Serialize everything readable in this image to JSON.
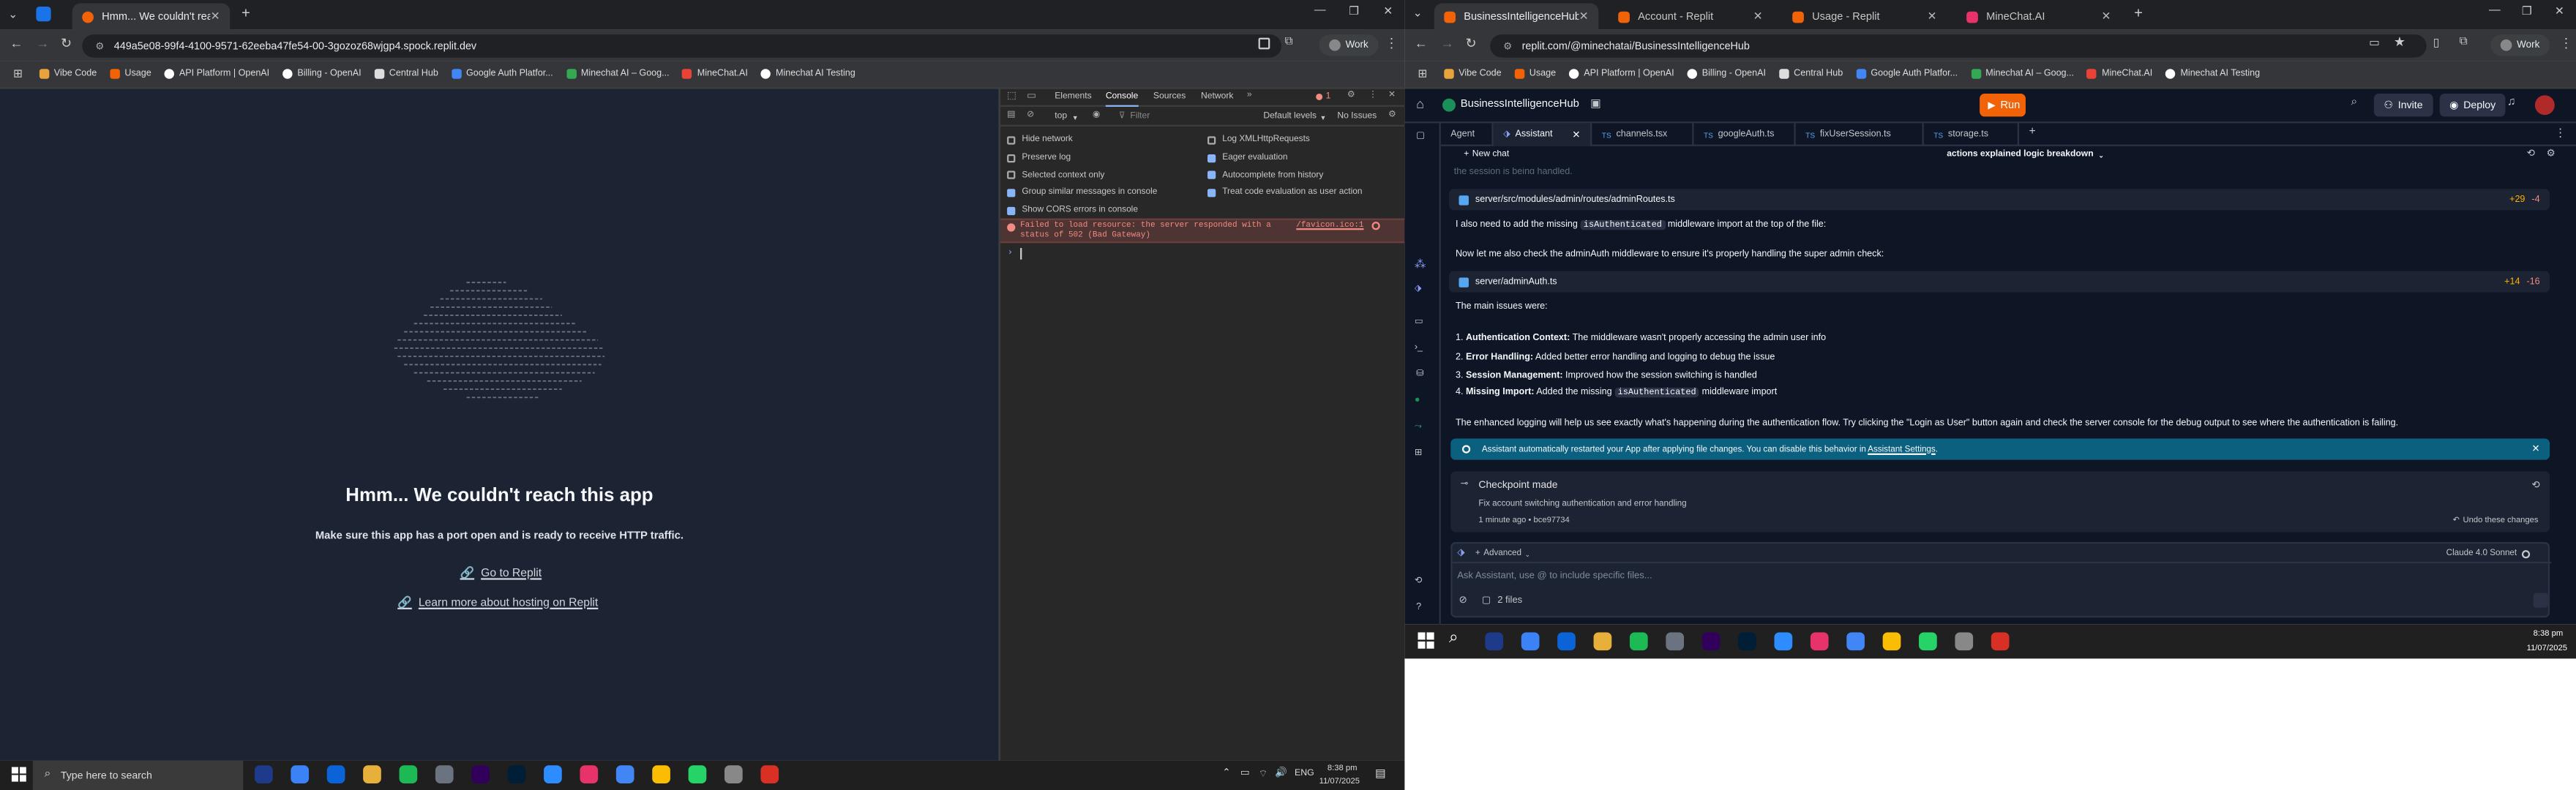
{
  "left_window": {
    "tabs": [
      {
        "title": "Hmm... We couldn't reach this app",
        "active": true
      }
    ],
    "url": "449a5e08-99f4-4100-9571-62eeba47fe54-00-3gozoz68wjgp4.spock.replit.dev",
    "profile": "Work",
    "bookmarks": [
      "Vibe Code",
      "Usage",
      "API Platform | OpenAI",
      "Billing - OpenAI",
      "Central Hub",
      "Google Auth Platfor...",
      "Minechat AI – Goog...",
      "MineChat.AI",
      "Minechat AI Testing"
    ],
    "error_page": {
      "title": "Hmm... We couldn't reach this app",
      "subtitle": "Make sure this app has a port open and is ready to receive HTTP traffic.",
      "link1": "Go to Replit",
      "link2": "Learn more about hosting on Replit"
    }
  },
  "devtools": {
    "tabs": [
      "Elements",
      "Console",
      "Sources",
      "Network"
    ],
    "active_tab": "Console",
    "error_count": "1",
    "context": "top",
    "filter_placeholder": "Filter",
    "levels": "Default levels",
    "issues": "No Issues",
    "settings_left": [
      {
        "label": "Hide network",
        "checked": false
      },
      {
        "label": "Preserve log",
        "checked": false
      },
      {
        "label": "Selected context only",
        "checked": false
      },
      {
        "label": "Group similar messages in console",
        "checked": true
      },
      {
        "label": "Show CORS errors in console",
        "checked": true
      }
    ],
    "settings_right": [
      {
        "label": "Log XMLHttpRequests",
        "checked": false
      },
      {
        "label": "Eager evaluation",
        "checked": true
      },
      {
        "label": "Autocomplete from history",
        "checked": true
      },
      {
        "label": "Treat code evaluation as user action",
        "checked": true
      }
    ],
    "error_message": "Failed to load resource: the server responded with a status of 502 (Bad Gateway)",
    "error_source": "/favicon.ico:1"
  },
  "right_window": {
    "tabs": [
      {
        "title": "BusinessIntelligenceHub - Repl",
        "active": true
      },
      {
        "title": "Account - Replit",
        "active": false
      },
      {
        "title": "Usage - Replit",
        "active": false
      },
      {
        "title": "MineChat.AI",
        "active": false
      }
    ],
    "url": "replit.com/@minechatai/BusinessIntelligenceHub",
    "profile": "Work",
    "bookmarks": [
      "Vibe Code",
      "Usage",
      "API Platform | OpenAI",
      "Billing - OpenAI",
      "Central Hub",
      "Google Auth Platfor...",
      "Minechat AI – Goog...",
      "MineChat.AI",
      "Minechat AI Testing"
    ]
  },
  "replit": {
    "project": "BusinessIntelligenceHub",
    "run": "Run",
    "invite": "Invite",
    "deploy": "Deploy",
    "tabs": [
      "Agent",
      "Assistant",
      "channels.tsx",
      "googleAuth.ts",
      "fixUserSession.ts",
      "storage.ts"
    ],
    "new_chat": "New chat",
    "chat_title": "actions explained logic breakdown",
    "cut_text": "the session is being handled.",
    "file1": {
      "path": "server/src/modules/admin/routes/adminRoutes.ts",
      "plus": "+29",
      "minus": "-4"
    },
    "msg1_a": "I also need to add the missing ",
    "msg1_code": "isAuthenticated",
    "msg1_b": " middleware import at the top of the file:",
    "msg2": "Now let me also check the adminAuth middleware to ensure it's properly handling the super admin check:",
    "file2": {
      "path": "server/adminAuth.ts",
      "plus": "+14",
      "minus": "-16"
    },
    "issues_heading": "The main issues were:",
    "issues": [
      {
        "n": "1.",
        "b": "Authentication Context:",
        "t": " The middleware wasn't properly accessing the admin user info"
      },
      {
        "n": "2.",
        "b": "Error Handling:",
        "t": " Added better error handling and logging to debug the issue"
      },
      {
        "n": "3.",
        "b": "Session Management:",
        "t": " Improved how the session switching is handled"
      }
    ],
    "issue4": {
      "n": "4.",
      "b": "Missing Import:",
      "t1": " Added the missing ",
      "code": "isAuthenticated",
      "t2": " middleware import"
    },
    "summary": "The enhanced logging will help us see exactly what's happening during the authentication flow. Try clicking the \"Login as User\" button again and check the server console for the debug output to see where the authentication is failing.",
    "notice": "Assistant automatically restarted your App after applying file changes. You can disable this behavior in ",
    "notice_link": "Assistant Settings",
    "notice_end": ".",
    "checkpoint_title": "Checkpoint made",
    "checkpoint_desc": "Fix account switching authentication and error handling",
    "checkpoint_meta": "1 minute ago  •  bce97734",
    "undo": "Undo these changes",
    "advanced": "Advanced",
    "model": "Claude 4.0 Sonnet",
    "input_placeholder": "Ask Assistant, use @ to include specific files...",
    "files": "2 files"
  },
  "taskbar_right": {
    "time": "8:38 pm",
    "date": "11/07/2025"
  },
  "taskbar_main": {
    "search_placeholder": "Type here to search",
    "lang": "ENG",
    "time": "8:38 pm",
    "date": "11/07/2025"
  },
  "colors": {
    "accent_orange": "#f26207",
    "replit_bg": "#0e1525",
    "panel": "#1c2333",
    "error_red": "#f28b82",
    "notice_blue": "#0b5f7f"
  }
}
